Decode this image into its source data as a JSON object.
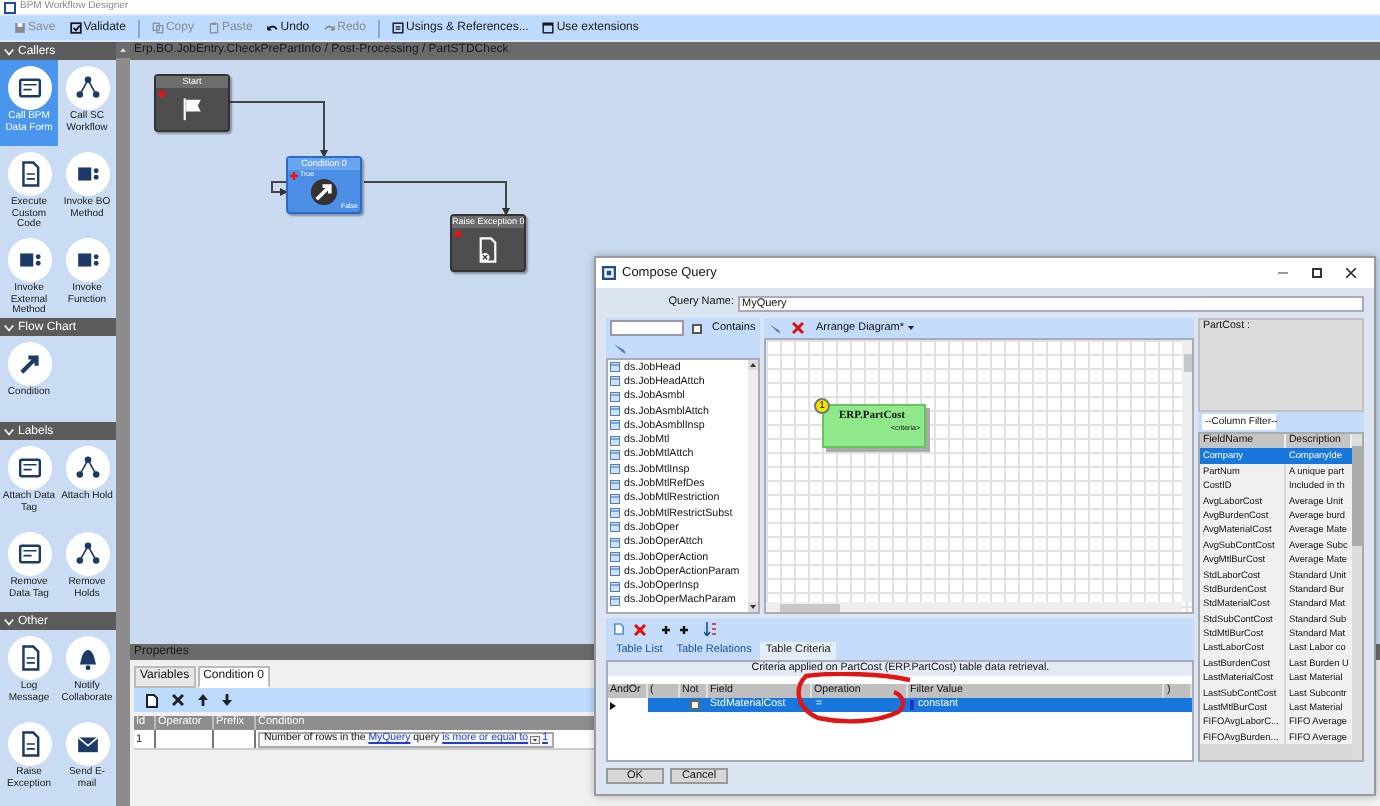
{
  "window": {
    "title": "BPM Workflow Designer"
  },
  "toolbar": [
    {
      "label": "Save",
      "disabled": true
    },
    {
      "label": "Validate",
      "disabled": false
    },
    {
      "label": "Copy",
      "disabled": true
    },
    {
      "label": "Paste",
      "disabled": true
    },
    {
      "label": "Undo",
      "disabled": false
    },
    {
      "label": "Redo",
      "disabled": true
    },
    {
      "label": "Usings & References...",
      "disabled": false
    },
    {
      "label": "Use extensions",
      "disabled": false
    }
  ],
  "palette": [
    {
      "title": "Callers",
      "items": [
        {
          "label": "Call BPM Data Form",
          "selected": true
        },
        {
          "label": "Call SC Workflow",
          "selected": false
        },
        {
          "label": "Execute Custom Code",
          "selected": false
        },
        {
          "label": "Invoke BO Method",
          "selected": false
        },
        {
          "label": "Invoke External Method",
          "selected": false
        },
        {
          "label": "Invoke Function",
          "selected": false
        }
      ]
    },
    {
      "title": "Flow Chart",
      "items": [
        {
          "label": "Condition",
          "selected": false
        }
      ]
    },
    {
      "title": "Labels",
      "items": [
        {
          "label": "Attach Data Tag",
          "selected": false
        },
        {
          "label": "Attach Hold",
          "selected": false
        },
        {
          "label": "Remove Data Tag",
          "selected": false
        },
        {
          "label": "Remove Holds",
          "selected": false
        }
      ]
    },
    {
      "title": "Other",
      "items": [
        {
          "label": "Log Message",
          "selected": false
        },
        {
          "label": "Notify Collaborate",
          "selected": false
        },
        {
          "label": "Raise Exception",
          "selected": false
        },
        {
          "label": "Send E-mail",
          "selected": false
        }
      ]
    }
  ],
  "breadcrumb": "Erp.BO.JobEntry.CheckPrePartInfo / Post-Processing / PartSTDCheck",
  "nodes": [
    {
      "kind": "start",
      "title": "Start",
      "selected": false
    },
    {
      "kind": "condition",
      "title": "Condition 0",
      "selected": true,
      "true_label": "True",
      "false_label": "False"
    },
    {
      "kind": "exception",
      "title": "Raise Exception 0",
      "selected": false
    }
  ],
  "properties": {
    "title": "Properties",
    "tabs": [
      {
        "label": "Variables",
        "selected": false
      },
      {
        "label": "Condition 0",
        "selected": true
      }
    ],
    "columns": [
      "Id",
      "Operator",
      "Prefix",
      "Condition"
    ],
    "rows": [
      {
        "id": "1",
        "condition": [
          {
            "kind": "text",
            "text": "Number of rows in the "
          },
          {
            "kind": "link",
            "text": "MyQuery"
          },
          {
            "kind": "text",
            "text": " query "
          },
          {
            "kind": "link",
            "text": "is more or equal to"
          },
          {
            "kind": "dropdown"
          },
          {
            "kind": "link",
            "text": "1"
          }
        ]
      }
    ]
  },
  "dialog": {
    "title": "Compose Query",
    "query_name_label": "Query Name:",
    "query_name": "MyQuery",
    "contains_label": "Contains",
    "contains_checked": false,
    "tables": [
      "ds.JobHead",
      "ds.JobHeadAttch",
      "ds.JobAsmbl",
      "ds.JobAsmblAttch",
      "ds.JobAsmblInsp",
      "ds.JobMtl",
      "ds.JobMtlAttch",
      "ds.JobMtlInsp",
      "ds.JobMtlRefDes",
      "ds.JobMtlRestriction",
      "ds.JobMtlRestrictSubst",
      "ds.JobOper",
      "ds.JobOperAttch",
      "ds.JobOperAction",
      "ds.JobOperActionParam",
      "ds.JobOperInsp",
      "ds.JobOperMachParam"
    ],
    "arrange_label": "Arrange Diagram*",
    "diagram_table": {
      "number": "1",
      "title": "ERP.PartCost",
      "subtitle": "<criteria>"
    },
    "detail_title": "PartCost :",
    "column_filter": "--Column Filter--",
    "field_columns": [
      "FieldName",
      "Description"
    ],
    "fields": [
      {
        "name": "Company",
        "description": "CompanyIde",
        "selected": true
      },
      {
        "name": "PartNum",
        "description": "A unique part",
        "selected": false
      },
      {
        "name": "CostID",
        "description": "Included in th",
        "selected": false
      },
      {
        "name": "AvgLaborCost",
        "description": "Average Unit",
        "selected": false
      },
      {
        "name": "AvgBurdenCost",
        "description": "Average burd",
        "selected": false
      },
      {
        "name": "AvgMaterialCost",
        "description": "Average Mate",
        "selected": false
      },
      {
        "name": "AvgSubContCost",
        "description": "Average Subc",
        "selected": false
      },
      {
        "name": "AvgMtlBurCost",
        "description": "Average Mate",
        "selected": false
      },
      {
        "name": "StdLaborCost",
        "description": "Standard Unit",
        "selected": false
      },
      {
        "name": "StdBurdenCost",
        "description": "Standard Bur",
        "selected": false
      },
      {
        "name": "StdMaterialCost",
        "description": "Standard Mat",
        "selected": false
      },
      {
        "name": "StdSubContCost",
        "description": "Standard Sub",
        "selected": false
      },
      {
        "name": "StdMtlBurCost",
        "description": "Standard Mat",
        "selected": false
      },
      {
        "name": "LastLaborCost",
        "description": "Last Labor co",
        "selected": false
      },
      {
        "name": "LastBurdenCost",
        "description": "Last Burden U",
        "selected": false
      },
      {
        "name": "LastMaterialCost",
        "description": "Last Material",
        "selected": false
      },
      {
        "name": "LastSubContCost",
        "description": "Last Subcontr",
        "selected": false
      },
      {
        "name": "LastMtlBurCost",
        "description": "Last Material",
        "selected": false
      },
      {
        "name": "FIFOAvgLaborC...",
        "description": "FIFO Average",
        "selected": false
      },
      {
        "name": "FIFOAvgBurden...",
        "description": "FIFO Average",
        "selected": false
      }
    ],
    "tabs": [
      {
        "label": "Table List",
        "selected": false
      },
      {
        "label": "Table Relations",
        "selected": false
      },
      {
        "label": "Table Criteria",
        "selected": true
      }
    ],
    "criteria_caption": "Criteria applied on PartCost (ERP.PartCost) table data retrieval.",
    "criteria_columns": [
      "AndOr",
      "(",
      "Not",
      "Field",
      "Operation",
      "Filter Value",
      ")"
    ],
    "criteria_rows": [
      {
        "selected": true,
        "not": false,
        "field": "StdMaterialCost",
        "operation": "=",
        "filter_value": "constant"
      }
    ],
    "buttons": [
      "OK",
      "Cancel"
    ]
  }
}
